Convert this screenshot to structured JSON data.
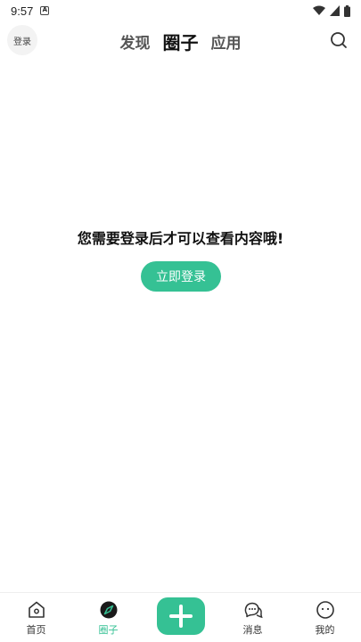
{
  "status": {
    "time": "9:57"
  },
  "header": {
    "login_label": "登录",
    "tabs": [
      {
        "label": "发现",
        "active": false
      },
      {
        "label": "圈子",
        "active": true
      },
      {
        "label": "应用",
        "active": false
      }
    ]
  },
  "main": {
    "message": "您需要登录后才可以查看内容哦!",
    "login_button": "立即登录"
  },
  "nav": {
    "items": [
      {
        "label": "首页",
        "icon": "home-icon"
      },
      {
        "label": "圈子",
        "icon": "compass-icon",
        "active": true
      },
      {
        "label": "",
        "icon": "plus-icon"
      },
      {
        "label": "消息",
        "icon": "chat-icon"
      },
      {
        "label": "我的",
        "icon": "profile-icon"
      }
    ]
  },
  "colors": {
    "accent": "#35c194"
  }
}
